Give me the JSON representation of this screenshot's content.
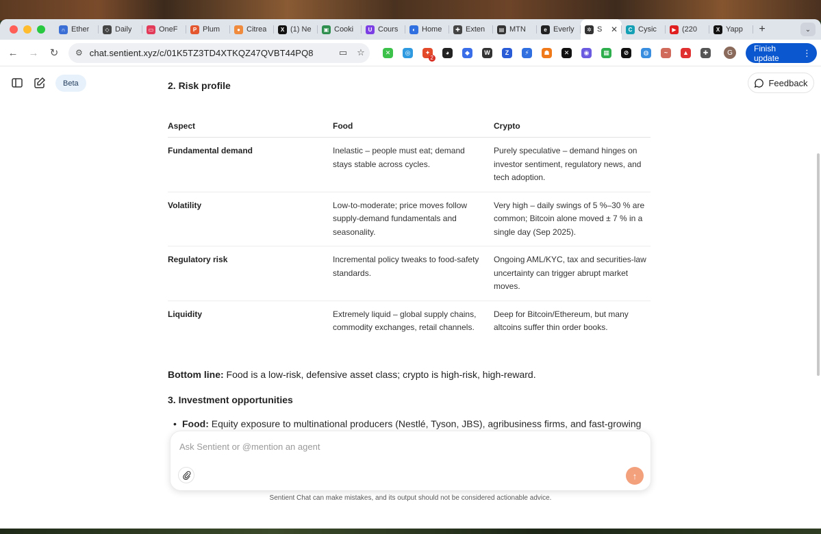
{
  "browser": {
    "tabs": [
      {
        "label": "Ether",
        "color": "#3b6fd6",
        "glyph": "∩"
      },
      {
        "label": "Daily",
        "color": "#444444",
        "glyph": "◇"
      },
      {
        "label": "OneF",
        "color": "#e23b5a",
        "glyph": "▭"
      },
      {
        "label": "Plum",
        "color": "#e4572e",
        "glyph": "P"
      },
      {
        "label": "Citrea",
        "color": "#f08a3c",
        "glyph": "●"
      },
      {
        "label": "(1) Ne",
        "color": "#111111",
        "glyph": "X"
      },
      {
        "label": "Cooki",
        "color": "#2f8f4e",
        "glyph": "▣"
      },
      {
        "label": "Cours",
        "color": "#7b3fe4",
        "glyph": "U"
      },
      {
        "label": "Home",
        "color": "#2f6fe0",
        "glyph": "◐"
      },
      {
        "label": "Exten",
        "color": "#444444",
        "glyph": "✚"
      },
      {
        "label": "MTN",
        "color": "#333333",
        "glyph": "▤"
      },
      {
        "label": "Everly",
        "color": "#222222",
        "glyph": "e"
      },
      {
        "label": "S",
        "color": "#333333",
        "glyph": "✲",
        "active": true
      },
      {
        "label": "Cysic",
        "color": "#16a0b5",
        "glyph": "C"
      },
      {
        "label": "(220",
        "color": "#e02020",
        "glyph": "▶"
      },
      {
        "label": "Yapp",
        "color": "#111111",
        "glyph": "X"
      }
    ],
    "url": "chat.sentient.xyz/c/01K5TZ3TD4XTKQZ47QVBT44PQ8",
    "extensions": [
      {
        "color": "#3cc24a",
        "glyph": "✕"
      },
      {
        "color": "#2f9ae0",
        "glyph": "◎"
      },
      {
        "color": "#e24a2a",
        "glyph": "✦",
        "badge": "2"
      },
      {
        "color": "#222222",
        "glyph": "◕"
      },
      {
        "color": "#3a6ee8",
        "glyph": "◆"
      },
      {
        "color": "#333333",
        "glyph": "W"
      },
      {
        "color": "#2a5bd7",
        "glyph": "Z"
      },
      {
        "color": "#2f6fe0",
        "glyph": "⚡"
      },
      {
        "color": "#f07a1a",
        "glyph": "☗"
      },
      {
        "color": "#111111",
        "glyph": "✕"
      },
      {
        "color": "#6b5be0",
        "glyph": "◉"
      },
      {
        "color": "#2fae4e",
        "glyph": "▦"
      },
      {
        "color": "#111111",
        "glyph": "⊘"
      },
      {
        "color": "#3a8ee0",
        "glyph": "◍"
      },
      {
        "color": "#d06a5a",
        "glyph": "~"
      },
      {
        "color": "#e03030",
        "glyph": "▲"
      },
      {
        "color": "#555555",
        "glyph": "✚"
      }
    ],
    "avatar": "G",
    "finish_update": "Finish update"
  },
  "app": {
    "beta": "Beta",
    "feedback": "Feedback"
  },
  "content": {
    "risk_title": "2. Risk profile",
    "table": {
      "headers": [
        "Aspect",
        "Food",
        "Crypto"
      ],
      "rows": [
        {
          "aspect": "Fundamental demand",
          "food": "Inelastic – people must eat; demand stays stable across cycles.",
          "crypto": "Purely speculative – demand hinges on investor sentiment, regulatory news, and tech adoption."
        },
        {
          "aspect": "Volatility",
          "food": "Low-to-moderate; price moves follow supply-demand fundamentals and seasonality.",
          "crypto": "Very high – daily swings of 5 %–30 % are common; Bitcoin alone moved ± 7 % in a single day (Sep 2025)."
        },
        {
          "aspect": "Regulatory risk",
          "food": "Incremental policy tweaks to food-safety standards.",
          "crypto": "Ongoing AML/KYC, tax and securities-law uncertainty can trigger abrupt market moves."
        },
        {
          "aspect": "Liquidity",
          "food": "Extremely liquid – global supply chains, commodity exchanges, retail channels.",
          "crypto": "Deep for Bitcoin/Ethereum, but many altcoins suffer thin order books."
        }
      ]
    },
    "bottom_line_label": "Bottom line:",
    "bottom_line_text": " Food is a low-risk, defensive asset class; crypto is high-risk, high-reward.",
    "investment_title": "3. Investment opportunities",
    "bullet_label": "Food:",
    "bullet_text": " Equity exposure to multinational producers (Nestlé, Tyson, JBS), agribusiness firms, and fast-growing plant-based companies; ESG-focused food ETFs; agricultural commodity ETFs; logistics and cold-storage play-outs"
  },
  "composer": {
    "placeholder": "Ask Sentient or @mention an agent",
    "disclaimer": "Sentient Chat can make mistakes, and its output should not be considered actionable advice."
  }
}
